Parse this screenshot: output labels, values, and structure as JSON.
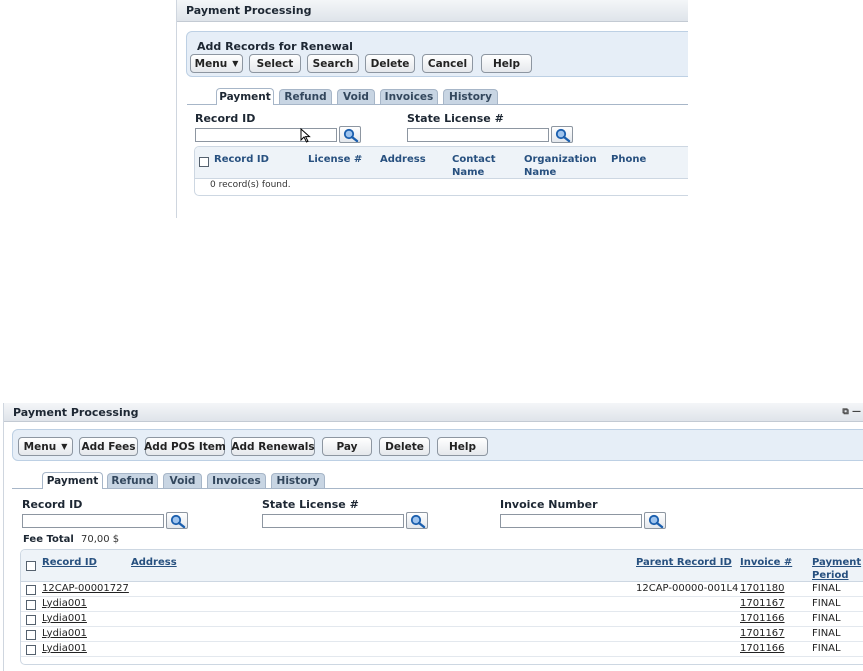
{
  "top_panel": {
    "title": "Payment Processing",
    "action_title": "Add Records for Renewal",
    "buttons": {
      "menu": "Menu",
      "select": "Select",
      "search": "Search",
      "delete": "Delete",
      "cancel": "Cancel",
      "help": "Help"
    },
    "tabs": [
      "Payment",
      "Refund",
      "Void",
      "Invoices",
      "History"
    ],
    "active_tab": "Payment",
    "fields": {
      "record_id_label": "Record ID",
      "record_id_value": "",
      "state_license_label": "State License #",
      "state_license_value": ""
    },
    "columns": {
      "record_id": "Record ID",
      "license": "License #",
      "address": "Address",
      "contact_name_1": "Contact",
      "contact_name_2": "Name",
      "org_name_1": "Organization",
      "org_name_2": "Name",
      "phone": "Phone"
    },
    "empty_message": "0 record(s) found."
  },
  "bottom_panel": {
    "title": "Payment Processing",
    "buttons": {
      "menu": "Menu",
      "add_fees": "Add Fees",
      "add_pos_item": "Add POS Item",
      "add_renewals": "Add Renewals",
      "pay": "Pay",
      "delete": "Delete",
      "help": "Help"
    },
    "tabs": [
      "Payment",
      "Refund",
      "Void",
      "Invoices",
      "History"
    ],
    "active_tab": "Payment",
    "fields": {
      "record_id_label": "Record ID",
      "record_id_value": "",
      "state_license_label": "State License #",
      "state_license_value": "",
      "invoice_number_label": "Invoice Number",
      "invoice_number_value": ""
    },
    "fee_total_label": "Fee Total",
    "fee_total_value": "70,00 $",
    "columns": {
      "record_id": "Record ID",
      "address": "Address",
      "parent_record_id": "Parent Record ID",
      "invoice": "Invoice #",
      "payment_period_1": "Payment",
      "payment_period_2": "Period"
    },
    "rows": [
      {
        "record_id": "12CAP-00001727",
        "parent_record_id": "12CAP-00000-001L4",
        "invoice": "1701180",
        "period": "FINAL"
      },
      {
        "record_id": "Lydia001",
        "parent_record_id": "",
        "invoice": "1701167",
        "period": "FINAL"
      },
      {
        "record_id": "Lydia001",
        "parent_record_id": "",
        "invoice": "1701166",
        "period": "FINAL"
      },
      {
        "record_id": "Lydia001",
        "parent_record_id": "",
        "invoice": "1701167",
        "period": "FINAL"
      },
      {
        "record_id": "Lydia001",
        "parent_record_id": "",
        "invoice": "1701166",
        "period": "FINAL"
      }
    ]
  },
  "colors": {
    "action_bg": "#e6eef7",
    "tab_inactive": "#c8d5e3",
    "link_blue": "#27507f"
  },
  "icons": {
    "search": "magnifier-icon",
    "menu_arrow": "menu-arrow-icon"
  }
}
